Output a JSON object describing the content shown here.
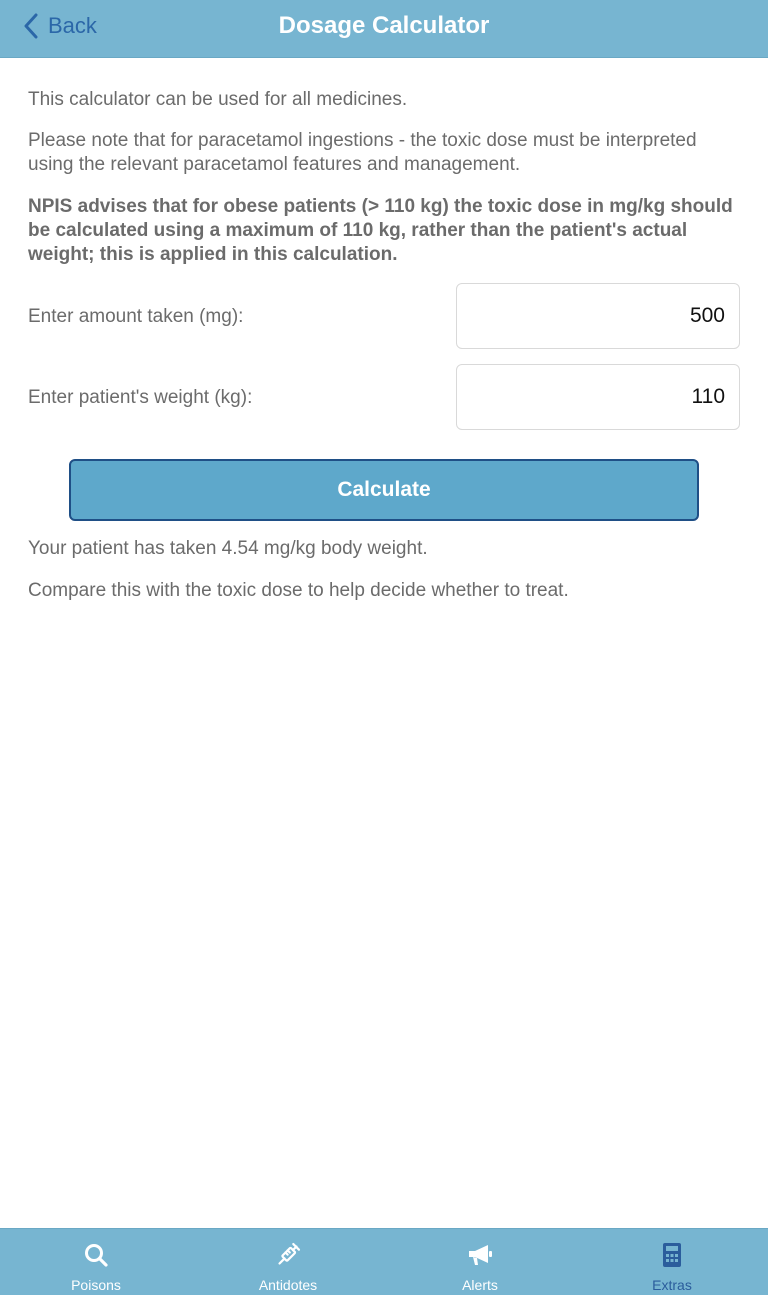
{
  "header": {
    "back_label": "Back",
    "title": "Dosage Calculator"
  },
  "content": {
    "intro": "This calculator can be used for all medicines.",
    "paracetamol_note": "Please note that for paracetamol ingestions - the toxic dose must be interpreted using the relevant paracetamol features and management.",
    "npis_advice": "NPIS advises that for obese patients (> 110 kg) the toxic dose in mg/kg should be calculated using a maximum of 110 kg, rather than the patient's actual weight; this is applied in this calculation."
  },
  "form": {
    "amount_label": "Enter amount taken (mg):",
    "amount_value": "500",
    "weight_label": "Enter patient's weight (kg):",
    "weight_value": "110",
    "calculate_label": "Calculate"
  },
  "result": {
    "summary": "Your patient has taken 4.54 mg/kg body weight.",
    "advice": "Compare this with the toxic dose to help decide whether to treat."
  },
  "tabs": [
    {
      "label": "Poisons",
      "icon": "search-icon",
      "active": false
    },
    {
      "label": "Antidotes",
      "icon": "syringe-icon",
      "active": false
    },
    {
      "label": "Alerts",
      "icon": "megaphone-icon",
      "active": false
    },
    {
      "label": "Extras",
      "icon": "calculator-icon",
      "active": true
    }
  ],
  "colors": {
    "header_bg": "#77b5d1",
    "accent": "#2b67a8",
    "button_bg": "#5ea8cb",
    "button_border": "#1f4f86",
    "text_gray": "#6b6b6b"
  }
}
